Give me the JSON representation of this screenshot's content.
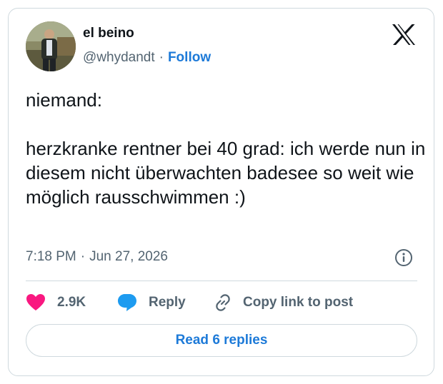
{
  "author": {
    "name": "el beino",
    "handle": "@whydandt",
    "separator": "·",
    "follow_label": "Follow"
  },
  "icons": {
    "logo": "x-logo-icon",
    "info": "info-icon",
    "like": "heart-icon",
    "reply": "speech-bubble-icon",
    "copy": "link-icon"
  },
  "tweet": {
    "line1": "niemand:",
    "line2": "herzkranke rentner bei 40 grad: ich werde nun in diesem nicht überwachten badesee so weit wie möglich rausschwimmen :)"
  },
  "meta": {
    "time": "7:18 PM",
    "separator": "·",
    "date": "Jun 27, 2026"
  },
  "actions": {
    "like_count": "2.9K",
    "reply_label": "Reply",
    "copy_label": "Copy link to post"
  },
  "read_replies_label": "Read 6 replies",
  "colors": {
    "like": "#f91880",
    "reply": "#1d9bf0",
    "link_blue": "#1d7ad8",
    "muted": "#536471",
    "border": "#cfd9de"
  }
}
